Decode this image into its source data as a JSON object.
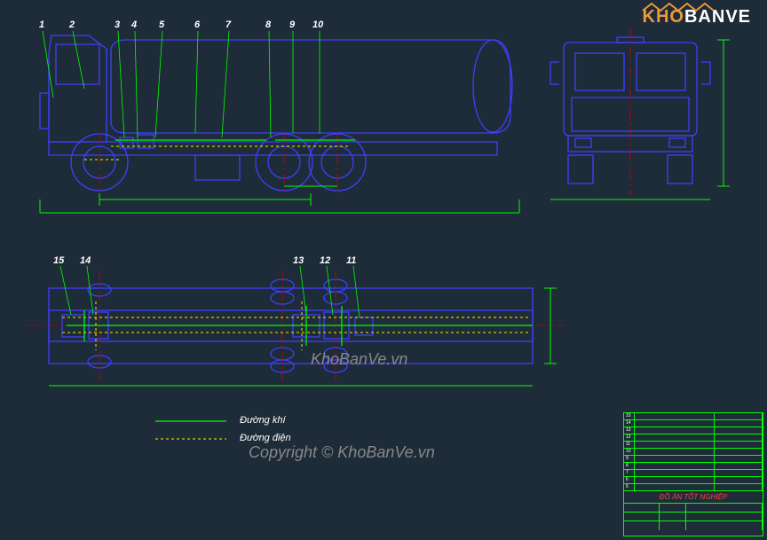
{
  "logo": {
    "part1": "KHO",
    "part2": "BANVE"
  },
  "watermarks": {
    "center": "KhoBanVe.vn",
    "copyright": "Copyright © KhoBanVe.vn"
  },
  "callouts_top": [
    "1",
    "2",
    "3",
    "4",
    "5",
    "6",
    "7",
    "8",
    "9",
    "10"
  ],
  "callouts_bottom": [
    "15",
    "14",
    "13",
    "12",
    "11"
  ],
  "legend": {
    "air_line": "Đường khí",
    "elec_line": "Đường điện"
  },
  "titleblock": {
    "title": "ĐỒ ÁN TỐT NGHIỆP",
    "rows_top": [
      [
        "15",
        "",
        ""
      ],
      [
        "14",
        "",
        ""
      ],
      [
        "13",
        "",
        ""
      ],
      [
        "12",
        "",
        ""
      ],
      [
        "11",
        "",
        ""
      ],
      [
        "10",
        "",
        ""
      ],
      [
        "9",
        "",
        ""
      ],
      [
        "8",
        "",
        ""
      ],
      [
        "7",
        "",
        ""
      ],
      [
        "6",
        "",
        ""
      ],
      [
        "5",
        "",
        ""
      ]
    ],
    "rows_bottom": [
      [
        "",
        "",
        "",
        "",
        ""
      ],
      [
        "",
        "",
        "",
        "",
        ""
      ],
      [
        "",
        "",
        "",
        "",
        ""
      ]
    ]
  }
}
